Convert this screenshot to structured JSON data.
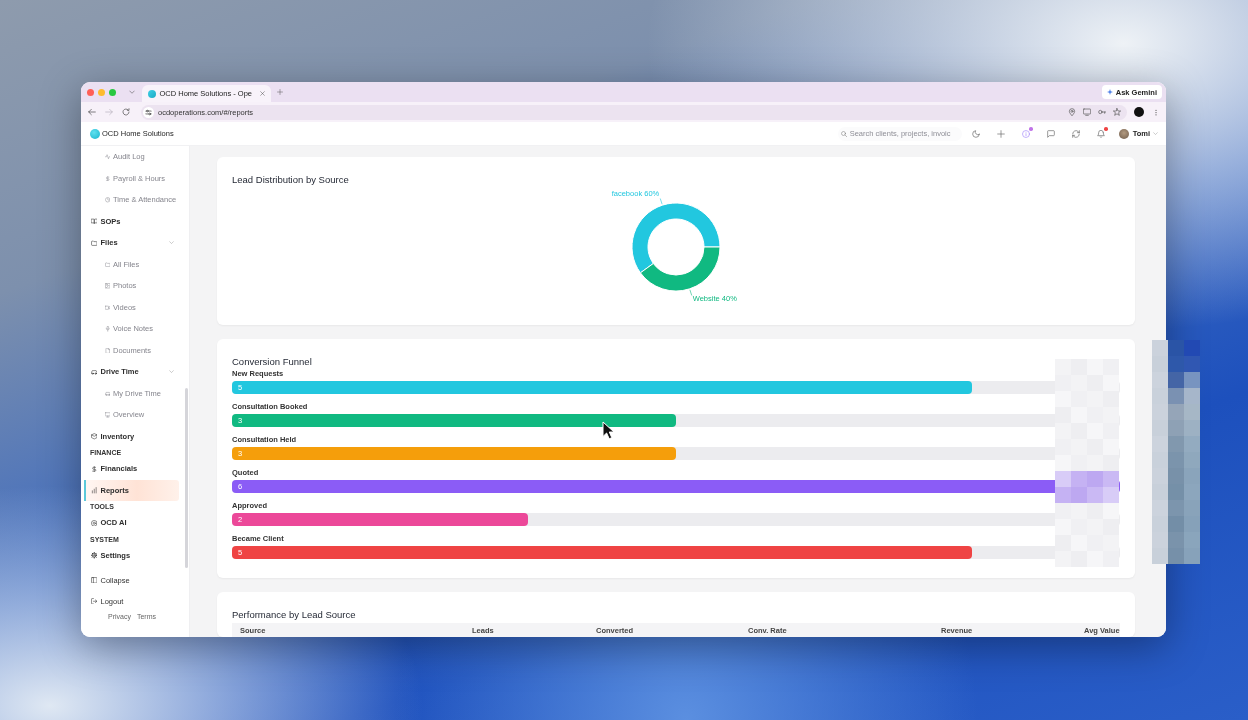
{
  "browser": {
    "tabs": [
      {
        "title": "OCD Home Solutions - Ope",
        "selected": true
      }
    ],
    "gemini_button": "Ask Gemini",
    "forward_disabled": true,
    "url": "ocdoperations.com/#/reports"
  },
  "app_header": {
    "brand": "OCD Home Solutions",
    "search": {
      "placeholder": "Search clients, projects, invoic"
    },
    "actions": [
      {
        "kind": "theme",
        "badge": false
      },
      {
        "kind": "add",
        "badge": false
      },
      {
        "kind": "info",
        "badge": true
      },
      {
        "kind": "messages",
        "badge": false
      },
      {
        "kind": "refresh",
        "badge": false
      },
      {
        "kind": "notifications",
        "badge": true
      }
    ],
    "user": {
      "name": "Tomi"
    }
  },
  "sidebar": {
    "top_subitems": [
      {
        "label": "Audit Log",
        "selected": false
      },
      {
        "label": "Payroll & Hours",
        "selected": false
      },
      {
        "label": "Time & Attendance",
        "selected": false
      }
    ],
    "sections": [
      {
        "items": [
          {
            "label": "SOPs",
            "selected": false
          },
          {
            "label": "Files",
            "selected": false,
            "expanded": true,
            "children": [
              {
                "label": "All Files",
                "selected": false
              },
              {
                "label": "Photos",
                "selected": false
              },
              {
                "label": "Videos",
                "selected": false
              },
              {
                "label": "Voice Notes",
                "selected": false
              },
              {
                "label": "Documents",
                "selected": false
              }
            ]
          },
          {
            "label": "Drive Time",
            "selected": false,
            "expanded": true,
            "children": [
              {
                "label": "My Drive Time",
                "selected": false
              },
              {
                "label": "Overview",
                "selected": false
              }
            ]
          },
          {
            "label": "Inventory",
            "selected": false
          }
        ]
      },
      {
        "heading": "FINANCE",
        "items": [
          {
            "label": "Financials",
            "selected": false
          },
          {
            "label": "Reports",
            "selected": true
          }
        ]
      },
      {
        "heading": "TOOLS",
        "items": [
          {
            "label": "OCD AI",
            "selected": false
          }
        ]
      },
      {
        "heading": "SYSTEM",
        "items": [
          {
            "label": "Settings",
            "selected": false
          }
        ]
      }
    ],
    "footer_actions": [
      "Collapse",
      "Logout"
    ],
    "legal_links": [
      "Privacy",
      "Terms"
    ]
  },
  "lead_distribution": {
    "chart_data": {
      "type": "donut",
      "title": "Lead Distribution by Source",
      "categories": [
        "facebook",
        "Website"
      ],
      "values": [
        60,
        40
      ],
      "colors": [
        "#22c7df",
        "#10b981"
      ],
      "value_labels": [
        "60%",
        "40%"
      ]
    }
  },
  "conversion_funnel": {
    "title": "Conversion Funnel",
    "stages": [
      {
        "label": "New Requests",
        "count": "5",
        "level": 0.833,
        "color": "#22c7df"
      },
      {
        "label": "Consultation Booked",
        "count": "3",
        "level": 0.5,
        "color": "#10b981"
      },
      {
        "label": "Consultation Held",
        "count": "3",
        "level": 0.5,
        "color": "#f59e0b"
      },
      {
        "label": "Quoted",
        "count": "6",
        "level": 1,
        "color": "#8b5cf6"
      },
      {
        "label": "Approved",
        "count": "2",
        "level": 0.333,
        "color": "#ec4899"
      },
      {
        "label": "Became Client",
        "count": "5",
        "level": 0.833,
        "color": "#ef4444"
      }
    ]
  },
  "lead_source_performance": {
    "title": "Performance by Lead Source",
    "table": {
      "columns": [
        "Source",
        "Leads",
        "Converted",
        "Conv. Rate",
        "Revenue",
        "Avg Value"
      ]
    }
  }
}
